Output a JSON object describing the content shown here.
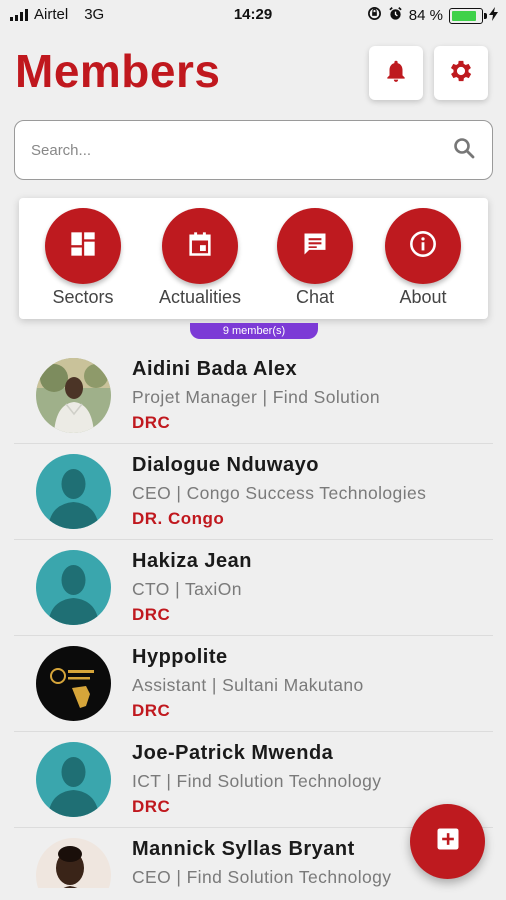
{
  "status_bar": {
    "carrier": "Airtel",
    "network": "3G",
    "time": "14:29",
    "battery": "84 %",
    "battery_level": 0.84
  },
  "header": {
    "title": "Members",
    "notifications_icon": "bell-icon",
    "settings_icon": "gear-icon"
  },
  "search": {
    "placeholder": "Search...",
    "value": "",
    "icon": "search-icon"
  },
  "quick_actions": [
    {
      "label": "Sectors",
      "icon": "grid-icon"
    },
    {
      "label": "Actualities",
      "icon": "calendar-icon"
    },
    {
      "label": "Chat",
      "icon": "chat-icon"
    },
    {
      "label": "About",
      "icon": "info-icon"
    }
  ],
  "member_count": "9 member(s)",
  "members": [
    {
      "name": "Aidini Bada Alex",
      "role": "Projet Manager | Find Solution",
      "country": "DRC",
      "avatar": "photo-man"
    },
    {
      "name": "Dialogue Nduwayo",
      "role": "CEO | Congo Success Technologies",
      "country": "DR. Congo",
      "avatar": "placeholder"
    },
    {
      "name": "Hakiza Jean",
      "role": "CTO | TaxiOn",
      "country": "DRC",
      "avatar": "placeholder"
    },
    {
      "name": "Hyppolite",
      "role": "Assistant | Sultani Makutano",
      "country": "DRC",
      "avatar": "logo"
    },
    {
      "name": "Joe-Patrick Mwenda",
      "role": "ICT | Find Solution Technology",
      "country": "DRC",
      "avatar": "placeholder"
    },
    {
      "name": "Mannick Syllas Bryant",
      "role": "CEO | Find Solution Technology",
      "country": "",
      "avatar": "photo-woman"
    }
  ],
  "fab_icon": "add-box-icon",
  "colors": {
    "brand_red": "#be1a1f",
    "badge_purple": "#7c3ad6",
    "avatar_teal": "#3aa6ad"
  }
}
